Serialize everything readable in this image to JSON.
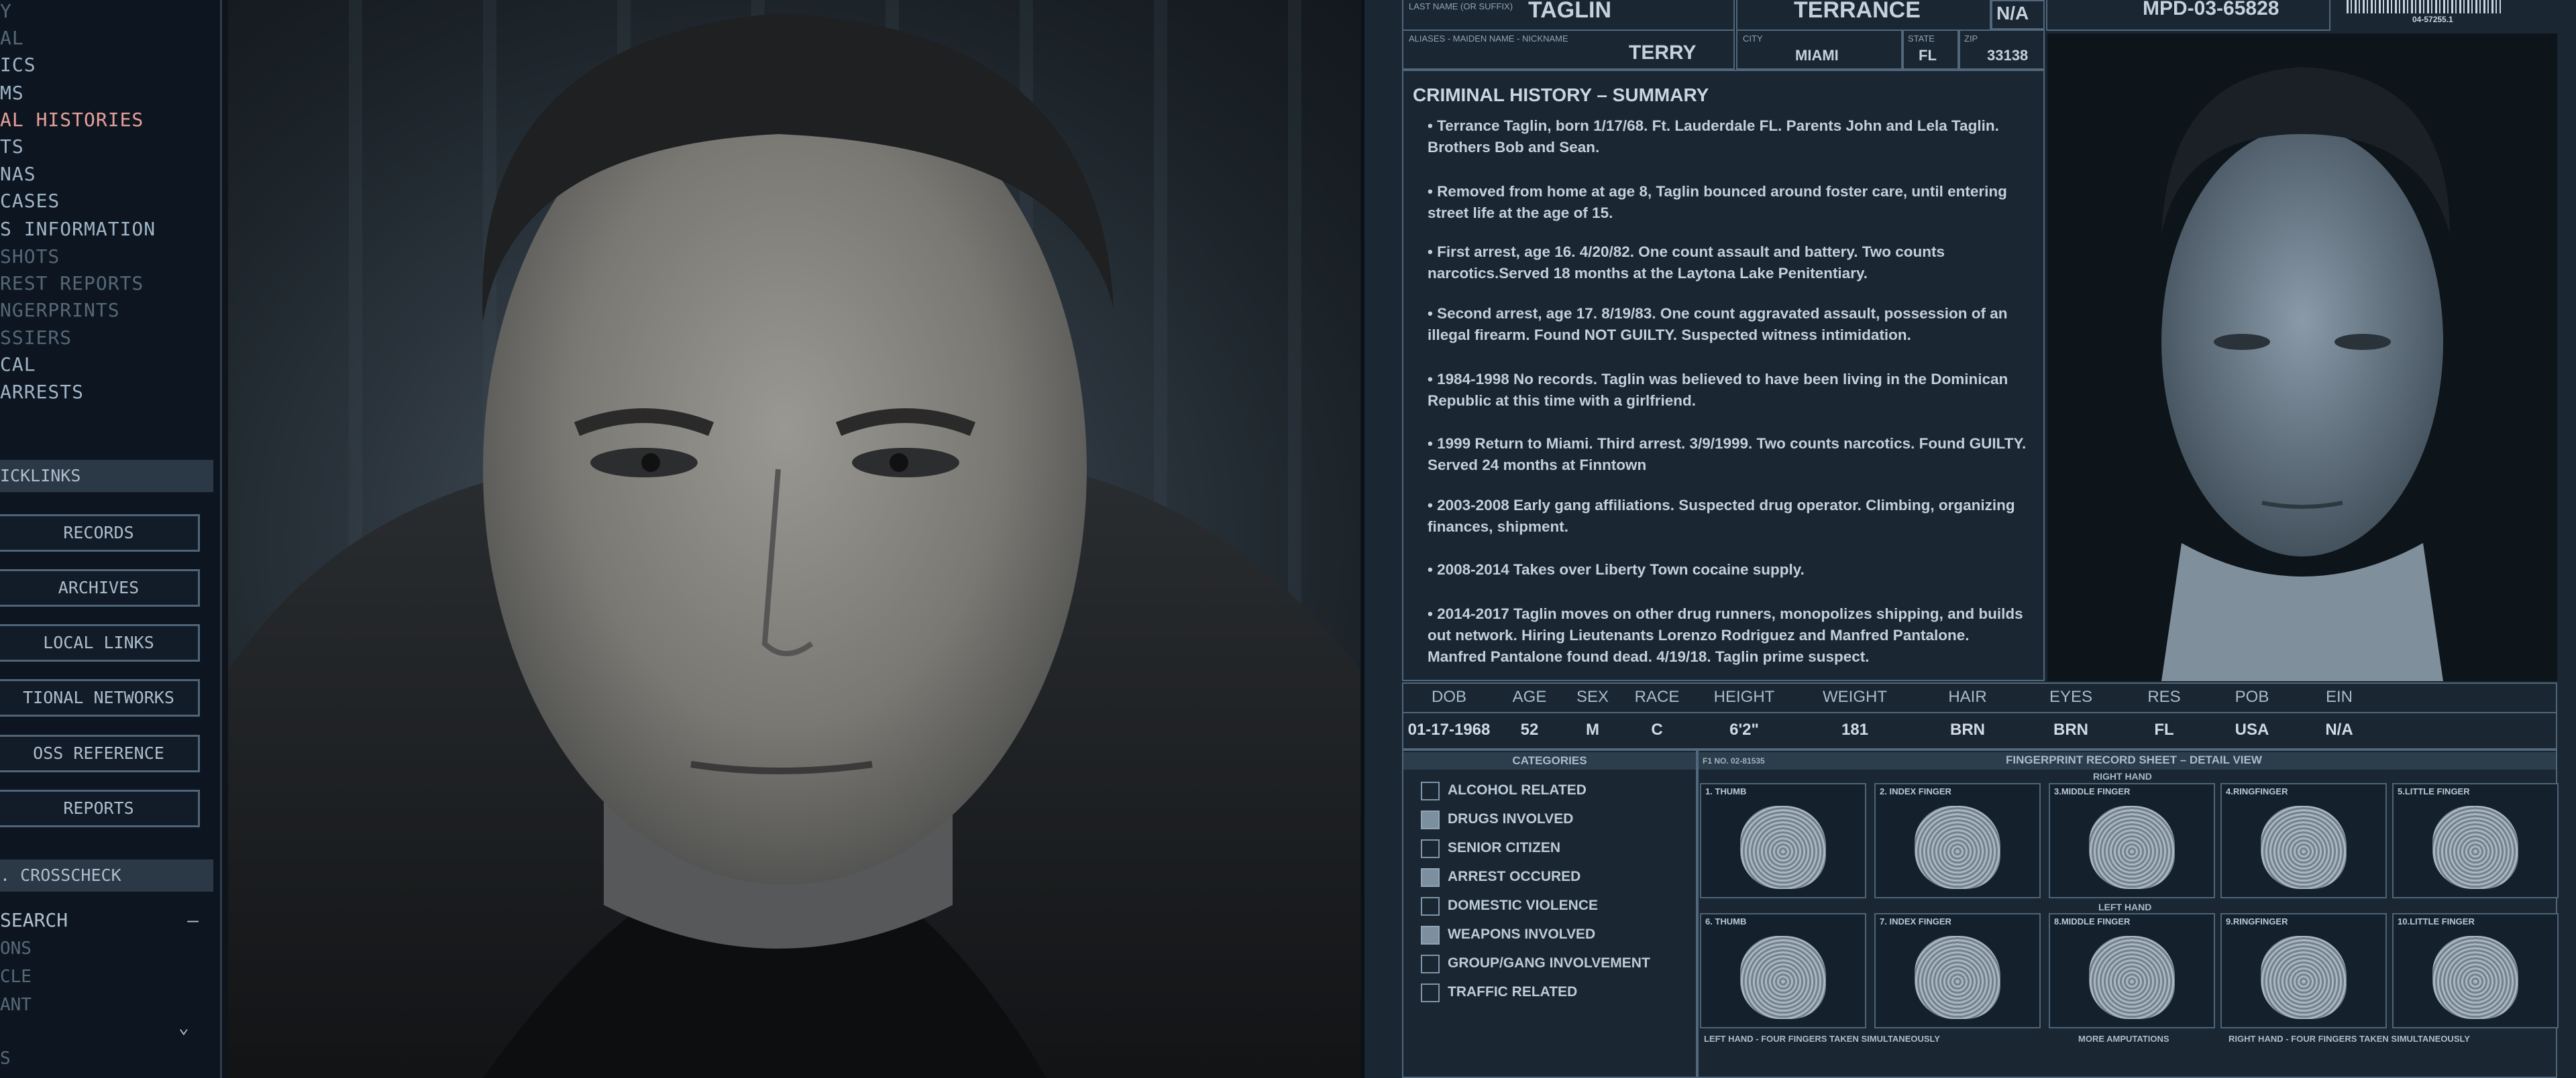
{
  "sidebar": {
    "menu": [
      {
        "label": "Y",
        "state": "dim"
      },
      {
        "label": "AL",
        "state": "dim"
      },
      {
        "label": "ICS",
        "state": "normal"
      },
      {
        "label": "MS",
        "state": "normal"
      },
      {
        "label": "AL HISTORIES",
        "state": "active"
      },
      {
        "label": "TS",
        "state": "normal"
      },
      {
        "label": "NAS",
        "state": "normal"
      },
      {
        "label": "CASES",
        "state": "normal"
      },
      {
        "label": "S INFORMATION",
        "state": "normal"
      },
      {
        "label": "SHOTS",
        "state": "dim"
      },
      {
        "label": "REST REPORTS",
        "state": "dim"
      },
      {
        "label": "NGERPRINTS",
        "state": "dim"
      },
      {
        "label": "SSIERS",
        "state": "dim"
      },
      {
        "label": "CAL",
        "state": "normal"
      },
      {
        "label": "ARRESTS",
        "state": "normal"
      }
    ],
    "quicklinks_header": "ICKLINKS",
    "quicklinks": [
      "RECORDS",
      "ARCHIVES",
      "LOCAL LINKS",
      "TIONAL NETWORKS",
      "OSS REFERENCE",
      "REPORTS"
    ],
    "crosscheck_header": ". CROSSCHECK",
    "search_label": "SEARCH",
    "search_collapse": "–",
    "search_items": [
      "ONS",
      "CLE",
      "ANT"
    ],
    "bottom_item": "S",
    "bottom_chevron": "⌄"
  },
  "record": {
    "last_name": "TAGLIN",
    "first_name": "TERRANCE",
    "middle": "N/A",
    "record_id": "MPD-03-65828",
    "barcode_number": "04-57255.1",
    "aliases_label": "ALIASES - MAIDEN NAME - NICKNAME",
    "last_name_label": "LAST NAME (OR SUFFIX)",
    "alias": "TERRY",
    "city_label": "CITY",
    "city": "MIAMI",
    "state_label": "STATE",
    "state": "FL",
    "zip_label": "ZIP",
    "zip": "33138"
  },
  "summary": {
    "title": "CRIMINAL HISTORY – SUMMARY",
    "paragraphs": [
      "• Terrance Taglin, born 1/17/68. Ft. Lauderdale FL. Parents John and Lela Taglin. Brothers Bob and Sean.",
      "• Removed from home at age 8, Taglin bounced around foster care, until entering street life at the age of 15.",
      "• First arrest, age 16. 4/20/82. One count assault and battery. Two counts narcotics.Served 18 months at the Laytona Lake Penitentiary.",
      "• Second arrest, age 17. 8/19/83. One count aggravated assault, possession of an illegal firearm. Found NOT GUILTY. Suspected witness intimidation.",
      "• 1984-1998 No records. Taglin was believed to have been living in the Dominican Republic at this time with a girlfriend.",
      "• 1999 Return to Miami. Third arrest. 3/9/1999. Two counts narcotics. Found GUILTY. Served 24 months at Finntown",
      "• 2003-2008 Early gang affiliations. Suspected drug operator. Climbing, organizing finances, shipment.",
      "• 2008-2014  Takes over Liberty Town cocaine supply.",
      "• 2014-2017  Taglin moves on other drug runners, monopolizes shipping, and builds out network. Hiring Lieutenants Lorenzo Rodriguez and Manfred Pantalone. Manfred Pantalone found dead. 4/19/18. Taglin prime suspect."
    ]
  },
  "stats": {
    "headers": [
      "DOB",
      "AGE",
      "SEX",
      "RACE",
      "HEIGHT",
      "WEIGHT",
      "HAIR",
      "EYES",
      "RES",
      "POB",
      "EIN"
    ],
    "values": [
      "01-17-1968",
      "52",
      "M",
      "C",
      "6'2\"",
      "181",
      "BRN",
      "BRN",
      "FL",
      "USA",
      "N/A"
    ]
  },
  "categories": {
    "title": "CATEGORIES",
    "items": [
      {
        "label": "ALCOHOL RELATED",
        "checked": false
      },
      {
        "label": "DRUGS INVOLVED",
        "checked": true
      },
      {
        "label": "SENIOR CITIZEN",
        "checked": false
      },
      {
        "label": "ARREST OCCURED",
        "checked": true
      },
      {
        "label": "DOMESTIC VIOLENCE",
        "checked": false
      },
      {
        "label": "WEAPONS INVOLVED",
        "checked": true
      },
      {
        "label": "GROUP/GANG INVOLVEMENT",
        "checked": false
      },
      {
        "label": "TRAFFIC RELATED",
        "checked": false
      }
    ]
  },
  "fingerprints": {
    "sheet_no": "F1 NO. 02-81535",
    "title": "FINGERPRINT RECORD SHEET – DETAIL VIEW",
    "right_hand_label": "RIGHT HAND",
    "left_hand_label": "LEFT HAND",
    "right": [
      "1. THUMB",
      "2. INDEX FINGER",
      "3.MIDDLE FINGER",
      "4.RINGFINGER",
      "5.LITTLE FINGER"
    ],
    "left": [
      "6. THUMB",
      "7. INDEX FINGER",
      "8.MIDDLE FINGER",
      "9.RINGFINGER",
      "10.LITTLE FINGER"
    ],
    "footer": [
      "LEFT HAND - FOUR FINGERS TAKEN SIMULTANEOUSLY",
      "MORE AMPUTATIONS",
      "RIGHT HAND - FOUR FINGERS TAKEN SIMULTANEOUSLY"
    ]
  },
  "colors": {
    "active_menu": "#e8a19a",
    "panel_bg": "#1a2631",
    "checked_box": "#7c8f9f"
  }
}
